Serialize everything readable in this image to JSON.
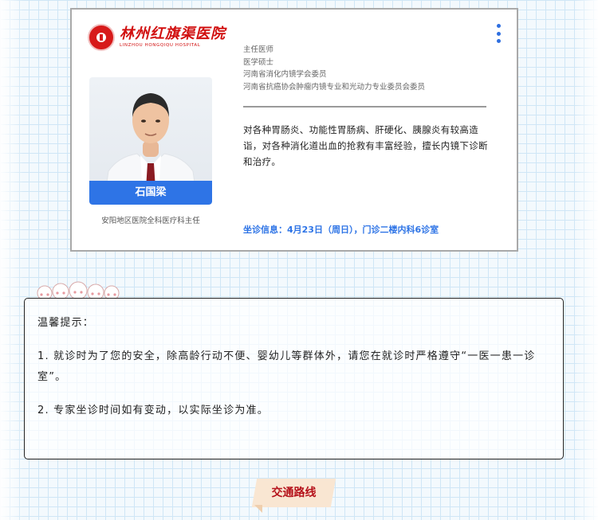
{
  "hospital": {
    "name_cn": "林州红旗渠医院",
    "name_en": "LINZHOU HONGQIQU HOSPITAL"
  },
  "doctor": {
    "name": "石国梁",
    "department": "安阳地区医院全科医疗科主任",
    "titles": [
      "主任医师",
      "医学硕士",
      "河南省消化内镜学会委员",
      "河南省抗癌协会肿瘤内镜专业和光动力专业委员会委员"
    ],
    "description": "对各种胃肠炎、功能性胃肠病、肝硬化、胰腺炎有较高造诣，对各种消化道出血的抢救有丰富经验，擅长内镜下诊断和治疗。",
    "visit_info": "坐诊信息：4月23日（周日），门诊二楼内科6诊室"
  },
  "notice": {
    "heading": "温馨提示：",
    "item1": "1. 就诊时为了您的安全，除高龄行动不便、婴幼儿等群体外，请您在就诊时严格遵守“一医一患一诊室”。",
    "item2": "2. 专家坐诊时间如有变动，以实际坐诊为准。"
  },
  "section_label": "交通路线",
  "colors": {
    "accent_blue": "#2e74e6",
    "brand_red": "#d10f0f",
    "banner_bg": "#f9e6d2",
    "banner_text": "#b5121b"
  },
  "icons": {
    "menu": "more-vertical-icon",
    "logo": "hospital-emblem-icon"
  }
}
